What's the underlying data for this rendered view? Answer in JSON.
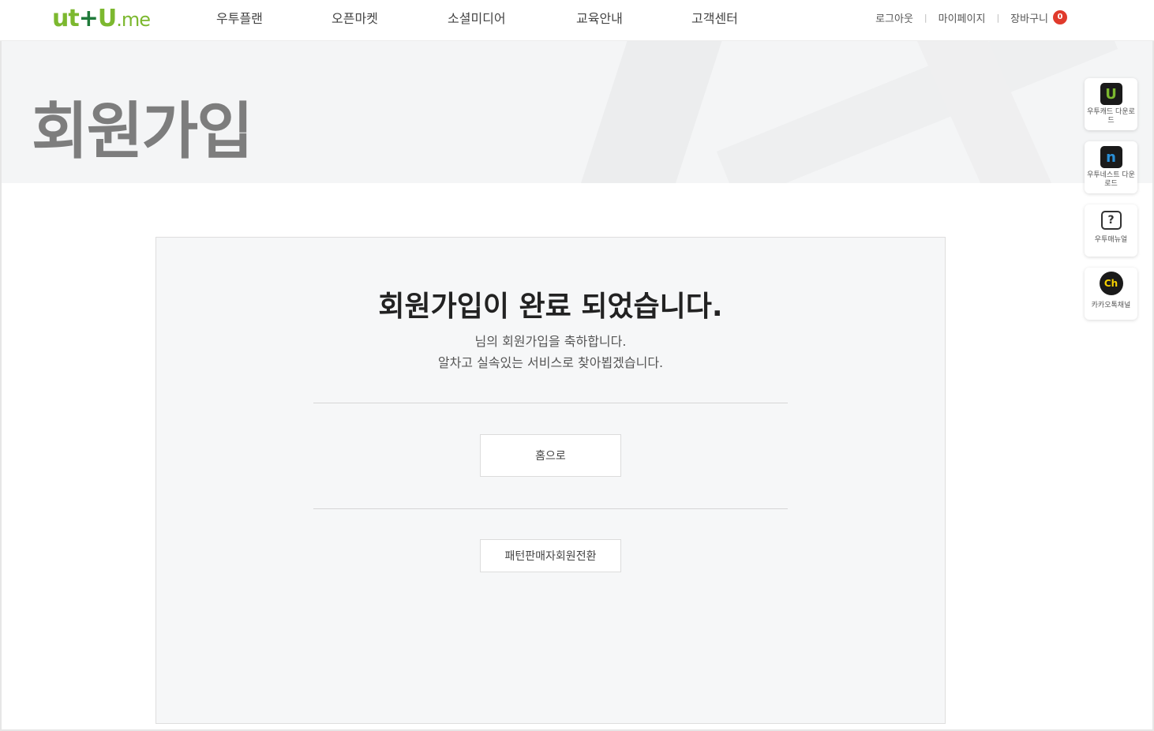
{
  "header": {
    "logo": {
      "part1": "ut",
      "plus": "+",
      "part2": "U",
      "suffix": ".me"
    },
    "nav": [
      "우투플랜",
      "오픈마켓",
      "소셜미디어",
      "교육안내",
      "고객센터"
    ],
    "util": {
      "logout": "로그아웃",
      "mypage": "마이페이지",
      "cart": "장바구니",
      "cart_count": "0",
      "separator": "|"
    }
  },
  "hero": {
    "title": "회원가입"
  },
  "quick_menu": [
    {
      "icon": "u-app-icon",
      "glyph": "U",
      "label": "우투캐드 다운로드",
      "color": "#7cb82f"
    },
    {
      "icon": "n-app-icon",
      "glyph": "n",
      "label": "우투네스트 다운로드",
      "color": "#2a8fd6"
    },
    {
      "icon": "manual-book-icon",
      "glyph": "?",
      "label": "우투매뉴얼",
      "color": "#333333"
    },
    {
      "icon": "kakao-channel-icon",
      "glyph": "Ch",
      "label": "카카오톡채널",
      "color": "#f5d000"
    }
  ],
  "main": {
    "title": "회원가입이 완료 되었습니다.",
    "message_line1": "님의 회원가입을 축하합니다.",
    "message_line2": "알차고 실속있는 서비스로 찾아뵙겠습니다.",
    "home_button": "홈으로",
    "convert_button": "패턴판매자회원전환"
  },
  "colors": {
    "brand_green": "#7cb82f",
    "badge_red": "#e03a2c"
  }
}
